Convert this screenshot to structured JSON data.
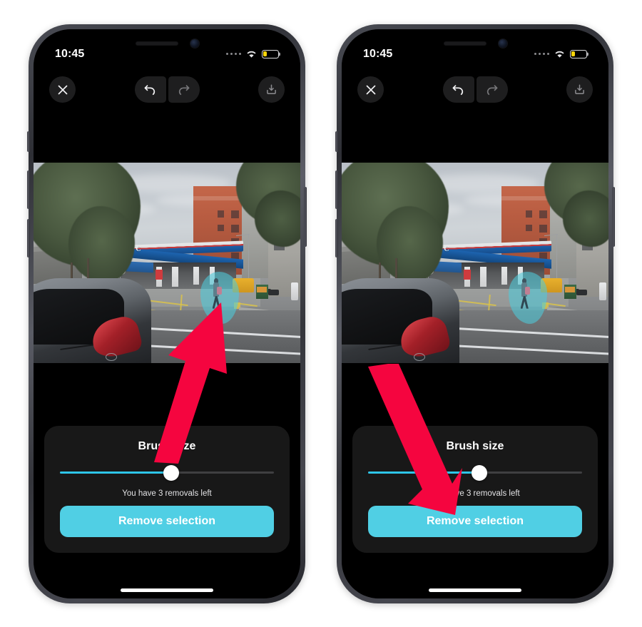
{
  "app": {
    "accent_cyan": "#50cfe4",
    "slider_cyan": "#2ec5e8",
    "selection_color": "#4dcdde",
    "annotation_red": "#f5053f",
    "panel_bg": "#181818",
    "screen_bg": "#000000"
  },
  "phones": [
    {
      "id": "phone-left",
      "status_bar": {
        "time": "10:45",
        "signal_icon": "signal-dots-icon",
        "wifi_icon": "wifi-icon",
        "battery_icon": "battery-low-icon",
        "battery_percent": 22
      },
      "toolbar": {
        "close_icon": "close-x-icon",
        "undo_icon": "undo-arrow-icon",
        "redo_icon": "redo-arrow-icon",
        "save_icon": "download-save-icon",
        "undo_enabled": true,
        "redo_enabled": false,
        "save_enabled": false
      },
      "photo": {
        "description": "Street scene with CPC gas station",
        "station_sign": "CPC",
        "banner_text": "平安自在",
        "selection_active": true
      },
      "panel": {
        "title": "Brush size",
        "slider_value_percent": 52,
        "removals_text": "You have 3 removals left",
        "button_label": "Remove selection"
      },
      "annotation": {
        "arrow_direction": "up-right",
        "points_at": "selection-blob"
      }
    },
    {
      "id": "phone-right",
      "status_bar": {
        "time": "10:45",
        "signal_icon": "signal-dots-icon",
        "wifi_icon": "wifi-icon",
        "battery_icon": "battery-low-icon",
        "battery_percent": 22
      },
      "toolbar": {
        "close_icon": "close-x-icon",
        "undo_icon": "undo-arrow-icon",
        "redo_icon": "redo-arrow-icon",
        "save_icon": "download-save-icon",
        "undo_enabled": true,
        "redo_enabled": false,
        "save_enabled": false
      },
      "photo": {
        "description": "Street scene with CPC gas station",
        "station_sign": "CPC",
        "banner_text": "平安自在",
        "selection_active": true
      },
      "panel": {
        "title": "Brush size",
        "slider_value_percent": 52,
        "removals_text": "You have 3 removals left",
        "button_label": "Remove selection"
      },
      "annotation": {
        "arrow_direction": "down-right",
        "points_at": "remove-selection-button"
      }
    }
  ]
}
